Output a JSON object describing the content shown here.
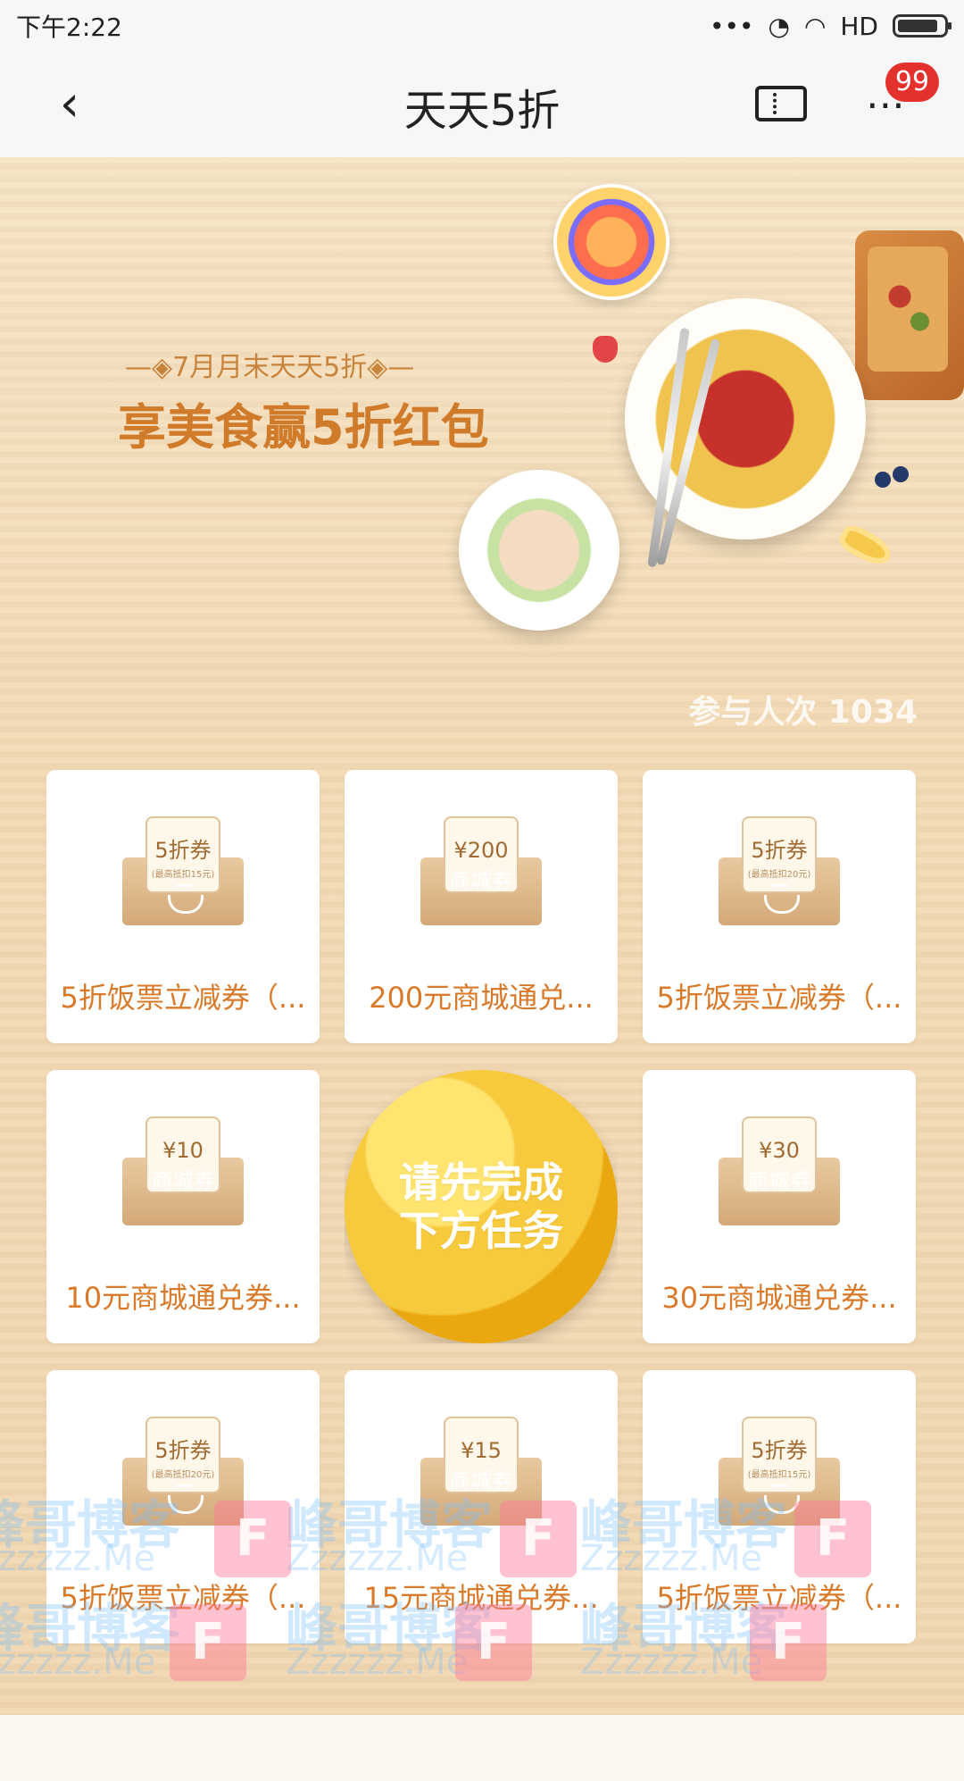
{
  "status_bar": {
    "time": "下午2:22",
    "signal": "HD"
  },
  "header": {
    "title": "天天5折",
    "badge": "99"
  },
  "promo": {
    "kicker": "—◈7月月末天天5折◈—",
    "headline": "享美食赢5折红包",
    "participants_label": "参与人次",
    "participants_value": "1034"
  },
  "cards": [
    {
      "paper_main": "5折券",
      "paper_sub": "(最高抵扣15元)",
      "env_label": "",
      "title": "5折饭票立减券（..."
    },
    {
      "paper_main": "¥200",
      "paper_sub": "",
      "env_label": "商城券",
      "title": "200元商城通兑..."
    },
    {
      "paper_main": "5折券",
      "paper_sub": "(最高抵扣20元)",
      "env_label": "",
      "title": "5折饭票立减券（..."
    },
    {
      "paper_main": "¥10",
      "paper_sub": "",
      "env_label": "商城券",
      "title": "10元商城通兑券..."
    },
    {
      "cta": "请先完成\n下方任务"
    },
    {
      "paper_main": "¥30",
      "paper_sub": "",
      "env_label": "商城券",
      "title": "30元商城通兑券..."
    },
    {
      "paper_main": "5折券",
      "paper_sub": "(最高抵扣20元)",
      "env_label": "",
      "title": "5折饭票立减券（..."
    },
    {
      "paper_main": "¥15",
      "paper_sub": "",
      "env_label": "商城券",
      "title": "15元商城通兑券..."
    },
    {
      "paper_main": "5折券",
      "paper_sub": "(最高抵扣15元)",
      "env_label": "",
      "title": "5折饭票立减券（..."
    }
  ],
  "watermark": {
    "line1": "峰哥博客",
    "line2": "Zzzzzz.Me",
    "letter": "F"
  },
  "colors": {
    "accent": "#d97a2a",
    "badge": "#e5312e",
    "cta": "#f7c93d"
  }
}
